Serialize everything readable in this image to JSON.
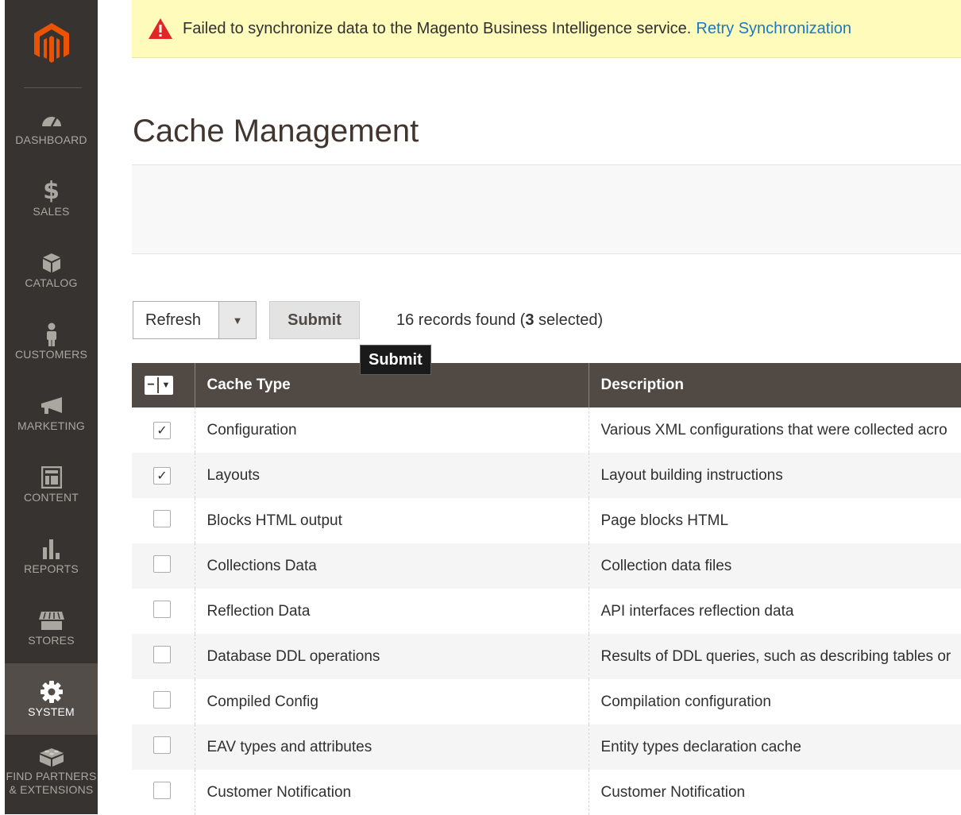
{
  "sidebar": {
    "logo": "magento-logo",
    "items": [
      {
        "label": "DASHBOARD",
        "icon": "dashboard-icon"
      },
      {
        "label": "SALES",
        "icon": "dollar-icon"
      },
      {
        "label": "CATALOG",
        "icon": "box-icon"
      },
      {
        "label": "CUSTOMERS",
        "icon": "person-icon"
      },
      {
        "label": "MARKETING",
        "icon": "megaphone-icon"
      },
      {
        "label": "CONTENT",
        "icon": "layout-icon"
      },
      {
        "label": "REPORTS",
        "icon": "bar-chart-icon"
      },
      {
        "label": "STORES",
        "icon": "storefront-icon"
      },
      {
        "label": "SYSTEM",
        "icon": "gear-icon",
        "active": true
      },
      {
        "label": "FIND PARTNERS",
        "label2": "& EXTENSIONS",
        "icon": "lego-block-icon"
      }
    ]
  },
  "alert": {
    "message": "Failed to synchronize data to the Magento Business Intelligence service.",
    "link": "Retry Synchronization",
    "icon": "warning-icon"
  },
  "page": {
    "title": "Cache Management"
  },
  "actions": {
    "select_value": "Refresh",
    "submit_label": "Submit",
    "records_prefix": "16 records found (",
    "selected_count": "3",
    "records_suffix": " selected)",
    "tooltip": "Submit"
  },
  "grid": {
    "headers": {
      "cache_type": "Cache Type",
      "description": "Description"
    },
    "rows": [
      {
        "type": "Configuration",
        "description": "Various XML configurations that were collected acro",
        "checked": true
      },
      {
        "type": "Layouts",
        "description": "Layout building instructions",
        "checked": true
      },
      {
        "type": "Blocks HTML output",
        "description": "Page blocks HTML",
        "checked": false
      },
      {
        "type": "Collections Data",
        "description": "Collection data files",
        "checked": false
      },
      {
        "type": "Reflection Data",
        "description": "API interfaces reflection data",
        "checked": false
      },
      {
        "type": "Database DDL operations",
        "description": "Results of DDL queries, such as describing tables or",
        "checked": false
      },
      {
        "type": "Compiled Config",
        "description": "Compilation configuration",
        "checked": false
      },
      {
        "type": "EAV types and attributes",
        "description": "Entity types declaration cache",
        "checked": false
      },
      {
        "type": "Customer Notification",
        "description": "Customer Notification",
        "checked": false
      }
    ]
  },
  "colors": {
    "sidebar_bg": "#373330",
    "header_bg": "#514943",
    "alert_bg": "#fffbbb",
    "accent": "#eb5202",
    "link": "#1979c3"
  }
}
